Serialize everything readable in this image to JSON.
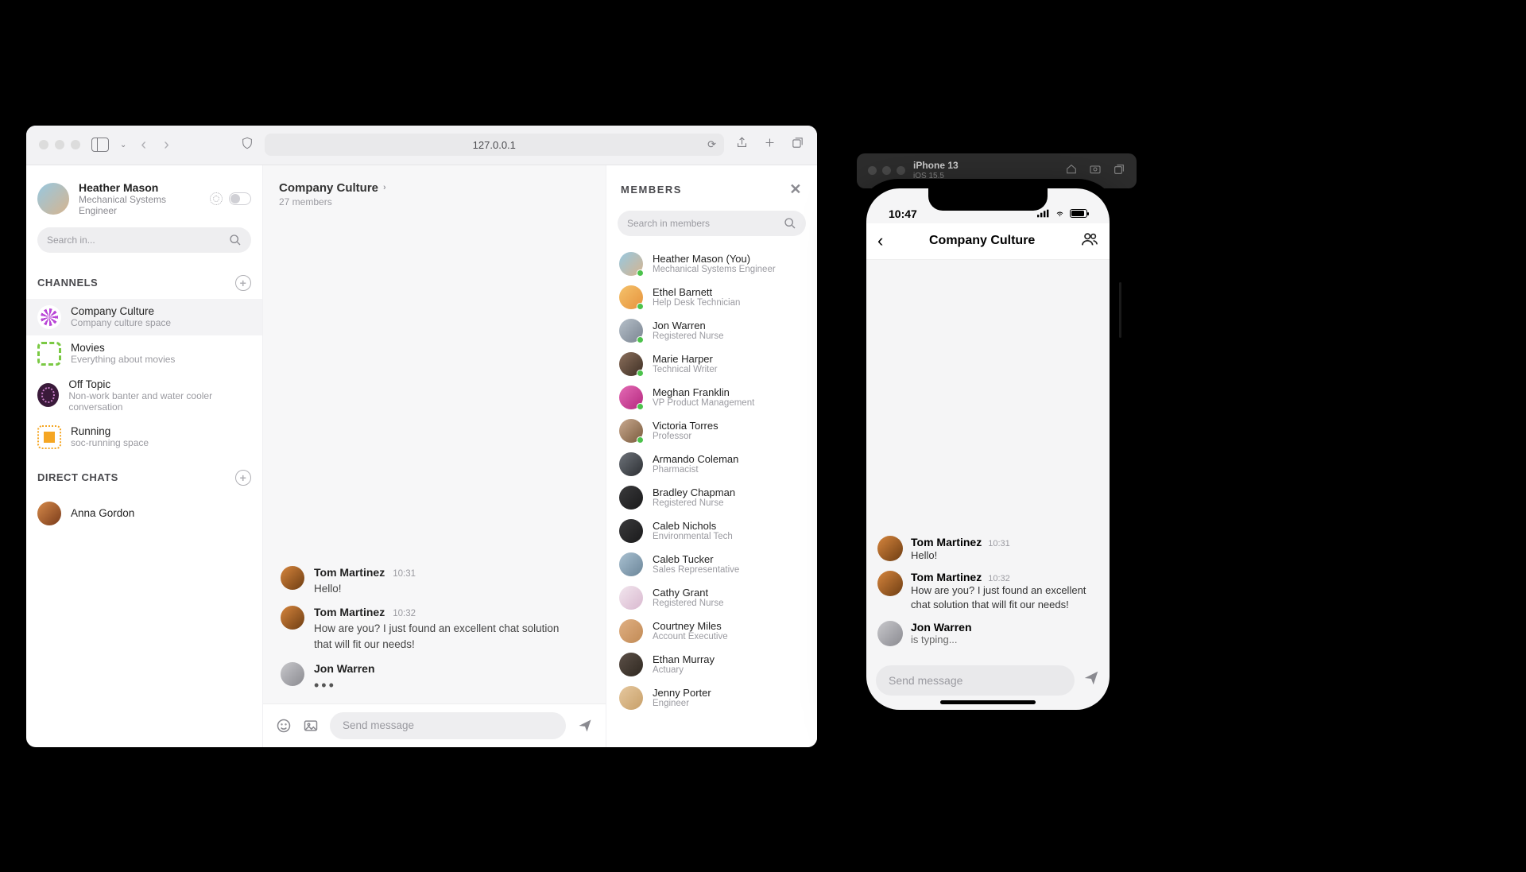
{
  "safari": {
    "url": "127.0.0.1"
  },
  "user": {
    "name": "Heather Mason",
    "role": "Mechanical Systems Engineer"
  },
  "search": {
    "placeholder": "Search in..."
  },
  "channelsHeader": "CHANNELS",
  "channels": [
    {
      "name": "Company Culture",
      "desc": "Company culture space"
    },
    {
      "name": "Movies",
      "desc": "Everything about movies"
    },
    {
      "name": "Off Topic",
      "desc": "Non-work banter and water cooler conversation"
    },
    {
      "name": "Running",
      "desc": "soc-running space"
    }
  ],
  "dmHeader": "DIRECT CHATS",
  "dms": [
    {
      "name": "Anna Gordon"
    }
  ],
  "thread": {
    "title": "Company Culture",
    "subtitle": "27 members",
    "messages": [
      {
        "author": "Tom Martinez",
        "time": "10:31",
        "text": "Hello!"
      },
      {
        "author": "Tom Martinez",
        "time": "10:32",
        "text": "How are you? I just found an excellent chat solution that will fit our needs!"
      },
      {
        "author": "Jon Warren",
        "time": "",
        "text": ""
      }
    ],
    "composerPlaceholder": "Send message"
  },
  "membersPanel": {
    "title": "MEMBERS",
    "searchPlaceholder": "Search in members",
    "list": [
      {
        "name": "Heather Mason (You)",
        "role": "Mechanical Systems Engineer",
        "online": true
      },
      {
        "name": "Ethel Barnett",
        "role": "Help Desk Technician",
        "online": true
      },
      {
        "name": "Jon Warren",
        "role": "Registered Nurse",
        "online": true
      },
      {
        "name": "Marie Harper",
        "role": "Technical Writer",
        "online": true
      },
      {
        "name": "Meghan Franklin",
        "role": "VP Product Management",
        "online": true
      },
      {
        "name": "Victoria Torres",
        "role": "Professor",
        "online": true
      },
      {
        "name": "Armando Coleman",
        "role": "Pharmacist",
        "online": false
      },
      {
        "name": "Bradley Chapman",
        "role": "Registered Nurse",
        "online": false
      },
      {
        "name": "Caleb Nichols",
        "role": "Environmental Tech",
        "online": false
      },
      {
        "name": "Caleb Tucker",
        "role": "Sales Representative",
        "online": false
      },
      {
        "name": "Cathy Grant",
        "role": "Registered Nurse",
        "online": false
      },
      {
        "name": "Courtney Miles",
        "role": "Account Executive",
        "online": false
      },
      {
        "name": "Ethan Murray",
        "role": "Actuary",
        "online": false
      },
      {
        "name": "Jenny Porter",
        "role": "Engineer",
        "online": false
      }
    ]
  },
  "simulator": {
    "device": "iPhone 13",
    "os": "iOS 15.5"
  },
  "phone": {
    "clock": "10:47",
    "title": "Company Culture",
    "messages": [
      {
        "author": "Tom Martinez",
        "time": "10:31",
        "text": "Hello!"
      },
      {
        "author": "Tom Martinez",
        "time": "10:32",
        "text": "How are you? I just found an excellent chat solution that will fit our needs!"
      },
      {
        "author": "Jon Warren",
        "typing": "is typing..."
      }
    ],
    "composerPlaceholder": "Send message"
  }
}
